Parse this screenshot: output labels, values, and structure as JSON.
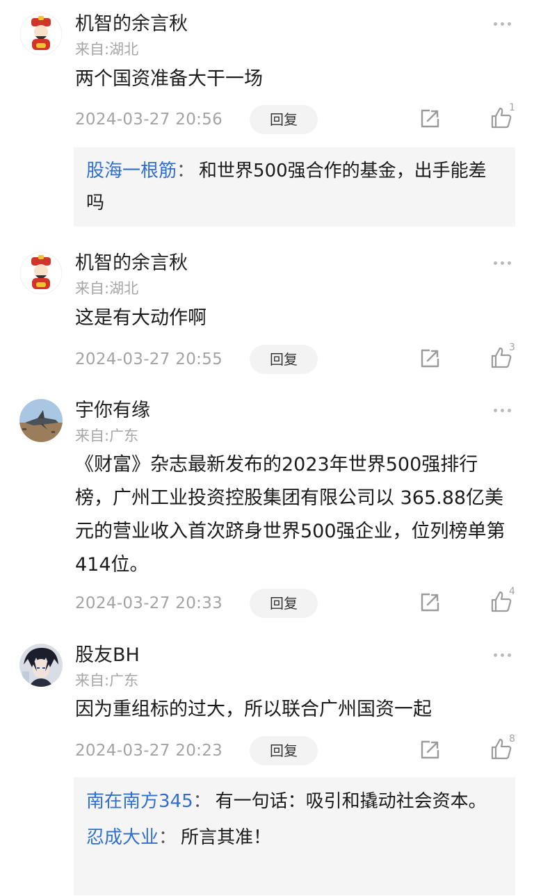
{
  "comments": [
    {
      "user": "机智的余言秋",
      "location": "来自:湖北",
      "text": "两个国资准备大干一场",
      "time": "2024-03-27 20:56",
      "reply_label": "回复",
      "likes": "1",
      "replies": [
        {
          "user": "股海一根筋",
          "colon": "：",
          "text": "和世界500强合作的基金，出手能差吗"
        }
      ]
    },
    {
      "user": "机智的余言秋",
      "location": "来自:湖北",
      "text": "这是有大动作啊",
      "time": "2024-03-27 20:55",
      "reply_label": "回复",
      "likes": "3"
    },
    {
      "user": "宇你有缘",
      "location": "来自:广东",
      "text": "《财富》杂志最新发布的2023年世界500强排行榜，广州工业投资控股集团有限公司以 365.88亿美元的营业收入首次跻身世界500强企业，位列榜单第414位。",
      "time": "2024-03-27 20:33",
      "reply_label": "回复",
      "likes": "4"
    },
    {
      "user": "股友BH",
      "location": "来自:广东",
      "text": "因为重组标的过大，所以联合广州国资一起",
      "time": "2024-03-27 20:23",
      "reply_label": "回复",
      "likes": "8",
      "replies": [
        {
          "user": "南在南方345",
          "colon": "：",
          "text": "有一句话：吸引和撬动社会资本。"
        },
        {
          "user": "忍成大业",
          "colon": "：",
          "text": "所言其准！"
        }
      ]
    }
  ],
  "icons": {
    "more": "more-dots-icon",
    "share": "share-icon",
    "like": "thumbs-up-icon"
  },
  "colors": {
    "link": "#2f6fd1",
    "meta": "#a3a3a3",
    "reply_bg": "#f5f5f5"
  }
}
